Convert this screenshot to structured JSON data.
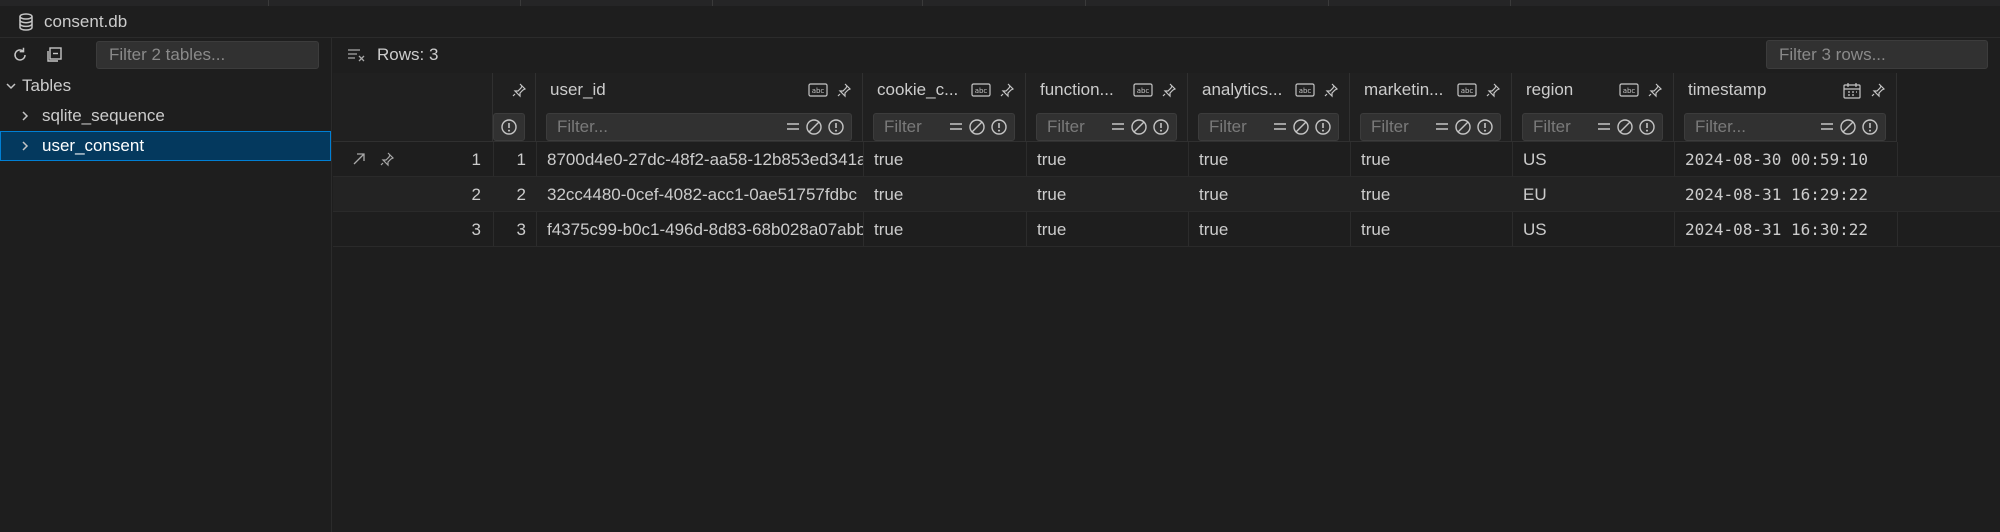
{
  "window": {
    "title": "consent.db",
    "title_icon": "database-icon"
  },
  "sidebar": {
    "toolbar": {
      "refresh_icon": "refresh-icon",
      "collapse_icon": "collapse-all-icon"
    },
    "filter_placeholder": "Filter 2 tables...",
    "root_label": "Tables",
    "items": [
      {
        "label": "sqlite_sequence"
      },
      {
        "label": "user_consent"
      }
    ]
  },
  "main": {
    "rows_label": "Rows: 3",
    "filter_rows_placeholder": "Filter 3 rows...",
    "columns": [
      {
        "name": "",
        "type_icon": "",
        "filter_placeholder": ""
      },
      {
        "name": "user_id",
        "type_icon": "text-type-icon",
        "filter_placeholder": "Filter..."
      },
      {
        "name": "cookie_c...",
        "type_icon": "text-type-icon",
        "filter_placeholder": "Filter"
      },
      {
        "name": "function...",
        "type_icon": "text-type-icon",
        "filter_placeholder": "Filter"
      },
      {
        "name": "analytics...",
        "type_icon": "text-type-icon",
        "filter_placeholder": "Filter"
      },
      {
        "name": "marketin...",
        "type_icon": "text-type-icon",
        "filter_placeholder": "Filter"
      },
      {
        "name": "region",
        "type_icon": "text-type-icon",
        "filter_placeholder": "Filter"
      },
      {
        "name": "timestamp",
        "type_icon": "calendar-icon",
        "filter_placeholder": "Filter..."
      }
    ],
    "rows": [
      {
        "rownum": "1",
        "id": "1",
        "user_id": "8700d4e0-27dc-48f2-aa58-12b853ed341a",
        "cookie": "true",
        "functional": "true",
        "analytics": "true",
        "marketing": "true",
        "region": "US",
        "timestamp": "2024-08-30 00:59:10"
      },
      {
        "rownum": "2",
        "id": "2",
        "user_id": "32cc4480-0cef-4082-acc1-0ae51757fdbc",
        "cookie": "true",
        "functional": "true",
        "analytics": "true",
        "marketing": "true",
        "region": "EU",
        "timestamp": "2024-08-31 16:29:22"
      },
      {
        "rownum": "3",
        "id": "3",
        "user_id": "f4375c99-b0c1-496d-8d83-68b028a07abb",
        "cookie": "true",
        "functional": "true",
        "analytics": "true",
        "marketing": "true",
        "region": "US",
        "timestamp": "2024-08-31 16:30:22"
      }
    ]
  },
  "colors": {
    "selection": "#04395e",
    "selection_border": "#007fd4",
    "background": "#1e1e1e"
  }
}
